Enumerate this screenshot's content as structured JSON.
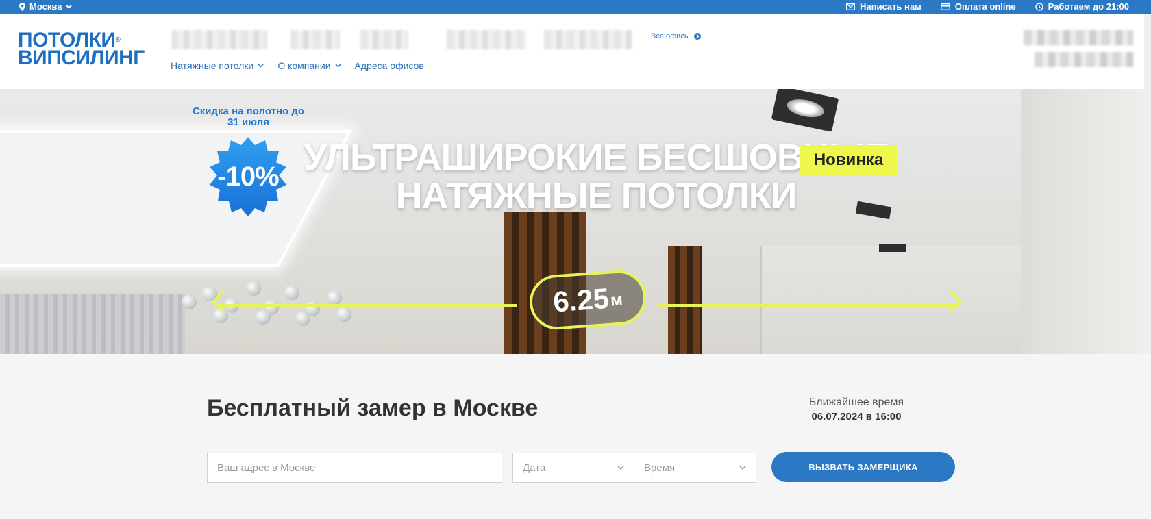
{
  "topbar": {
    "city": "Москва",
    "write_us": "Написать нам",
    "pay_online": "Оплата online",
    "hours": "Работаем до 21:00"
  },
  "header": {
    "logo_line1": "ПОТОЛКИ",
    "logo_line2": "ВИПСИЛИНГ",
    "all_offices": "Все офисы",
    "nav": [
      {
        "label": "Натяжные потолки"
      },
      {
        "label": "О компании"
      },
      {
        "label": "Адреса офисов"
      }
    ]
  },
  "hero": {
    "promo_text": "Скидка на полотно до 31 июля",
    "discount": "-10%",
    "headline": "УЛЬТРАШИРОКИЕ БЕСШОВНЫЕ НАТЯЖНЫЕ ПОТОЛКИ",
    "new_badge": "Новинка",
    "width_value": "6.25",
    "width_unit": "м"
  },
  "form": {
    "title": "Бесплатный замер в Москве",
    "nearest_label": "Ближайшее время",
    "nearest_value": "06.07.2024 в 16:00",
    "address_placeholder": "Ваш адрес в Москве",
    "date_placeholder": "Дата",
    "time_placeholder": "Время",
    "submit_label": "ВЫЗВАТЬ ЗАМЕРЩИКА"
  },
  "colors": {
    "brand_blue": "#2b78c4",
    "accent_yellow": "#eef84c",
    "badge_blue": "#1f8ee8"
  }
}
